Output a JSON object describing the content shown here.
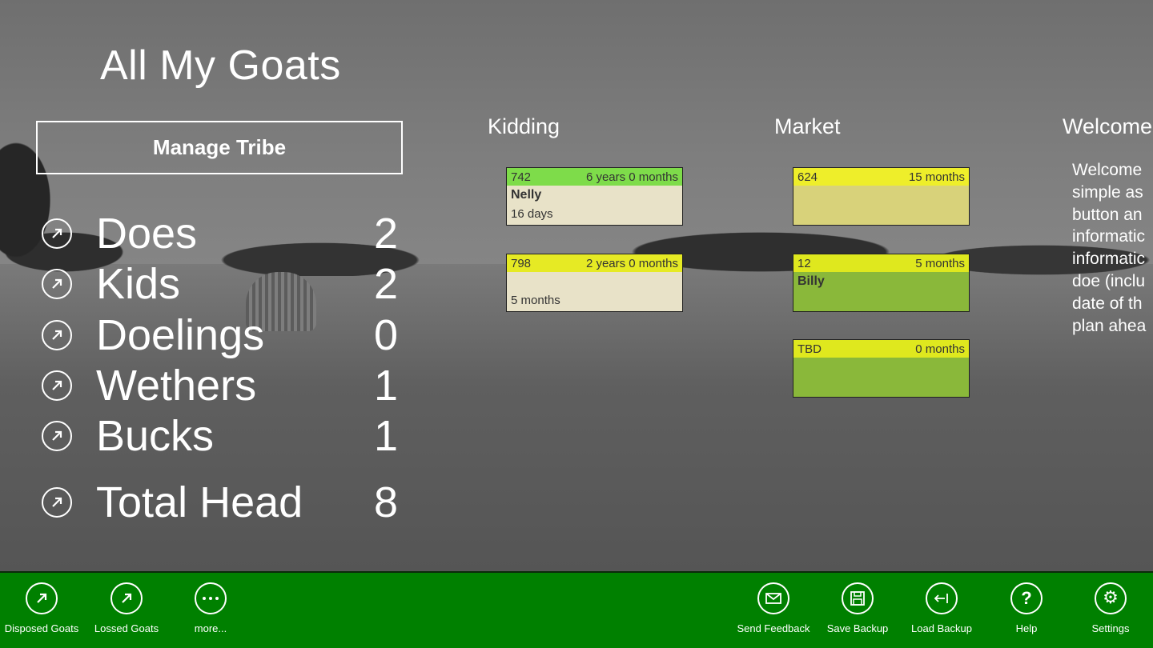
{
  "app": {
    "title": "All My Goats"
  },
  "manage_button": "Manage Tribe",
  "stats": [
    {
      "label": "Does",
      "count": "2"
    },
    {
      "label": "Kids",
      "count": "2"
    },
    {
      "label": "Doelings",
      "count": "0"
    },
    {
      "label": "Wethers",
      "count": "1"
    },
    {
      "label": "Bucks",
      "count": "1"
    },
    {
      "label": "Total Head",
      "count": "8"
    }
  ],
  "kidding": {
    "heading": "Kidding",
    "cards": [
      {
        "id": "742",
        "age": "6 years 0 months",
        "name": "Nelly",
        "detail": "16 days",
        "header_color": "#7edc4a",
        "body_color": "#e8e2c8"
      },
      {
        "id": "798",
        "age": "2 years 0 months",
        "name": "",
        "detail": "5 months",
        "header_color": "#e6ea24",
        "body_color": "#e8e2c8"
      }
    ]
  },
  "market": {
    "heading": "Market",
    "cards": [
      {
        "id": "624",
        "age": "15 months",
        "name": "",
        "detail": "",
        "header_color": "#eeee2a",
        "body_color": "#d8d27a"
      },
      {
        "id": "12",
        "age": "5 months",
        "name": "Billy",
        "detail": "",
        "header_color": "#dfe81e",
        "body_color": "#8ab83a"
      },
      {
        "id": "TBD",
        "age": "0 months",
        "name": "",
        "detail": "",
        "header_color": "#dfe81e",
        "body_color": "#8ab83a"
      }
    ]
  },
  "welcome": {
    "heading": "Welcome",
    "lines": [
      "Welcome",
      "simple as",
      "button an",
      "informatic",
      "informatic",
      "doe (inclu",
      "date of th",
      "plan ahea"
    ]
  },
  "appbar": {
    "left": [
      {
        "label": "Disposed Goats",
        "icon": "arrow-up-right-icon"
      },
      {
        "label": "Lossed Goats",
        "icon": "arrow-up-right-icon"
      },
      {
        "label": "more...",
        "icon": "more-icon"
      }
    ],
    "right": [
      {
        "label": "Send Feedback",
        "icon": "mail-icon"
      },
      {
        "label": "Save Backup",
        "icon": "save-icon"
      },
      {
        "label": "Load Backup",
        "icon": "load-icon"
      },
      {
        "label": "Help",
        "icon": "help-icon"
      },
      {
        "label": "Settings",
        "icon": "gear-icon"
      }
    ],
    "color": "#008000"
  }
}
